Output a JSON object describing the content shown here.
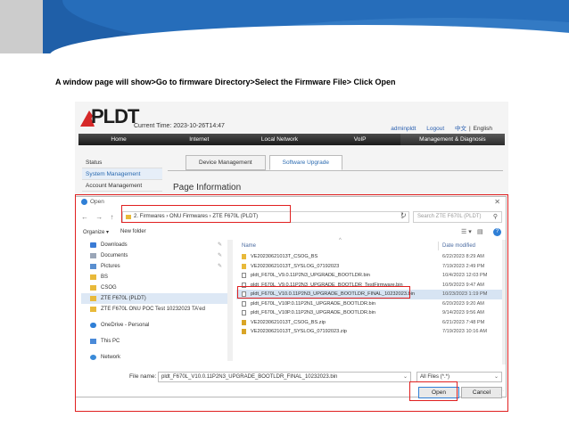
{
  "slide": {
    "caption": "A window page will show>Go to firmware Directory>Select the Firmware File> Click Open"
  },
  "router": {
    "logo_text": "PLDT",
    "current_time": "Current Time: 2023-10-26T14:47",
    "user": "adminpldt",
    "logout": "Logout",
    "lang_cn": "中文",
    "lang_sep": "|",
    "lang_en": "English",
    "nav": [
      "Home",
      "Internet",
      "Local Network",
      "VoIP",
      "Management & Diagnosis"
    ],
    "sidebar": [
      "Status",
      "System Management",
      "Account Management"
    ],
    "tabs": [
      "Device Management",
      "Software Upgrade"
    ],
    "page_heading": "Page Information"
  },
  "dialog": {
    "title": "Open",
    "close": "✕",
    "nav_back": "←",
    "nav_forward": "→",
    "nav_up": "↑",
    "address": "2. Firmwares  ›  ONU Firmwares  ›  ZTE F670L (PLDT)",
    "address_prefix": "›",
    "search_placeholder": "Search ZTE F670L (PLDT)",
    "organize": "Organize ▾",
    "new_folder": "New folder",
    "help": "?",
    "nav_pane": [
      {
        "label": "Downloads",
        "icon": "download-icon",
        "pinned": true
      },
      {
        "label": "Documents",
        "icon": "documents-icon",
        "pinned": true
      },
      {
        "label": "Pictures",
        "icon": "pictures-icon",
        "pinned": true
      },
      {
        "label": "BS",
        "icon": "folder-icon",
        "pinned": false
      },
      {
        "label": "CSOG",
        "icon": "folder-icon",
        "pinned": false
      },
      {
        "label": "ZTE F670L (PLDT)",
        "icon": "folder-icon",
        "pinned": false,
        "selected": true
      },
      {
        "label": "ZTE F670L ONU POC Test 10232023 TA'ed",
        "icon": "folder-icon",
        "pinned": false
      }
    ],
    "nav_pane_lower": [
      {
        "label": "OneDrive - Personal",
        "icon": "onedrive-icon"
      },
      {
        "label": "This PC",
        "icon": "this-pc-icon"
      },
      {
        "label": "Network",
        "icon": "network-icon"
      }
    ],
    "columns": {
      "name": "Name",
      "date": "Date modified"
    },
    "files": [
      {
        "name": "VE20230621013T_CSOG_BS",
        "date": "6/22/2023 8:29 AM",
        "kind": "folder"
      },
      {
        "name": "VE20230621013T_SYSLOG_07192023",
        "date": "7/19/2023 2:49 PM",
        "kind": "folder"
      },
      {
        "name": "pldt_F670L_V9.0.11P2N3_UPGRADE_BOOTLDR.bin",
        "date": "10/4/2023 12:03 PM",
        "kind": "file"
      },
      {
        "name": "pldt_F670L_V9.0.11P2N3_UPGRADE_BOOTLDR_TestFirmware.bin",
        "date": "10/9/2023 9:47 AM",
        "kind": "file"
      },
      {
        "name": "pldt_F670L_V10.0.11P2N3_UPGRADE_BOOTLDR_FINAL_10232023.bin",
        "date": "10/23/2023 1:19 PM",
        "kind": "file",
        "selected": true
      },
      {
        "name": "pldt_F670L_V10P.0.11P2N1_UPGRADE_BOOTLDR.bin",
        "date": "6/20/2023 9:20 AM",
        "kind": "file"
      },
      {
        "name": "pldt_F670L_V10P.0.11P2N3_UPGRADE_BOOTLDR.bin",
        "date": "9/14/2023 9:56 AM",
        "kind": "file"
      },
      {
        "name": "VE20230621013T_CSOG_BS.zip",
        "date": "6/21/2023 7:48 PM",
        "kind": "zip"
      },
      {
        "name": "VE20230621013T_SYSLOG_07192023.zip",
        "date": "7/19/2023 10:16 AM",
        "kind": "zip"
      }
    ],
    "file_name_label": "File name:",
    "file_name_value": "pldt_F670L_V10.0.11P2N3_UPGRADE_BOOTLDR_FINAL_10232023.bin",
    "file_type": "All Files (*.*)",
    "open_label": "Open",
    "cancel_label": "Cancel"
  },
  "colors": {
    "accent": "#e02020",
    "brand_blue": "#1f5fa8",
    "selection": "#d7e4f3"
  }
}
